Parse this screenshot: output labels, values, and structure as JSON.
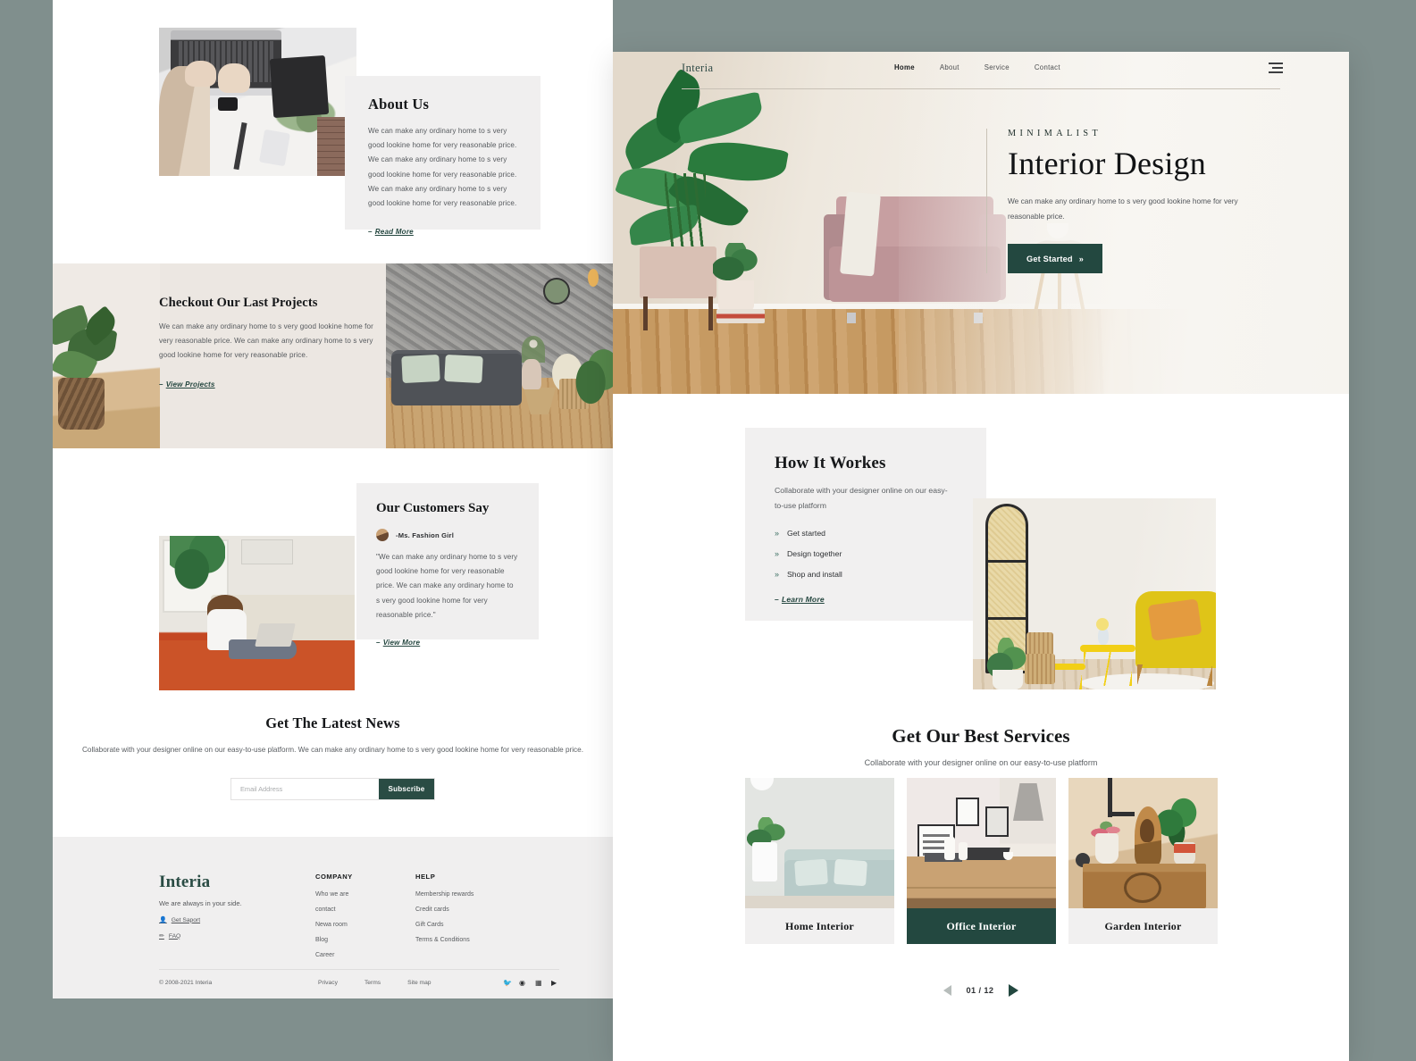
{
  "theme": {
    "canvas_bg": "#808f8d",
    "accent_green": "#234840",
    "panel_grey": "#f1f0f0",
    "band_beige": "#ece7e2"
  },
  "left_screen": {
    "about": {
      "title": "About Us",
      "body": "We can make any ordinary home to s very good lookine home for very reasonable price. We can make any ordinary home to s very good lookine home for very reasonable price. We can make any ordinary home to s very good lookine home for very reasonable price.",
      "link": "Read More",
      "link_dash": "–",
      "photo_alt": "hands-typing-on-laptop-photo"
    },
    "projects": {
      "title": "Checkout Our Last Projects",
      "body": "We can make any ordinary home to s very good lookine home for very reasonable price. We can make any ordinary home to s very good lookine home for very reasonable price.",
      "link": "View Projects",
      "link_dash": "–",
      "photo_alt": "grey-sofa-concrete-wall-living-room-photo"
    },
    "testimonial": {
      "title": "Our Customers Say",
      "author": "-Ms. Fashion Girl",
      "quote": "\"We can make any ordinary home to s very good lookine home for very reasonable price. We can make any ordinary home to s very good lookine home for very reasonable price.\"",
      "link": "View More",
      "link_dash": "–",
      "photo_alt": "woman-sitting-on-floor-with-laptop-photo"
    },
    "newsletter": {
      "title": "Get The Latest News",
      "subtitle": "Collaborate with your designer online on our easy-to-use platform. We can make any ordinary home to s very good lookine home for very reasonable price.",
      "email_placeholder": "Email Address",
      "email_value": "",
      "subscribe_label": "Subscribe"
    },
    "footer": {
      "logo": "Interia",
      "tagline": "We are always in your side.",
      "support_link": "Get Saport",
      "faq_link": "FAQ",
      "columns": [
        {
          "heading": "COMPANY",
          "links": [
            "Who we are",
            "contact",
            "Newa room",
            "Blog",
            "Career"
          ]
        },
        {
          "heading": "HELP",
          "links": [
            "Membership rewards",
            "Credit cards",
            "Gift Cards",
            "Terms & Conditions"
          ]
        }
      ],
      "copyright": "© 2008-2021 Interia",
      "bottom_links": [
        "Privacy",
        "Terms",
        "Site map"
      ],
      "socials": [
        "twitter-icon",
        "facebook-icon",
        "linkedin-icon",
        "youtube-icon"
      ]
    }
  },
  "right_screen": {
    "nav": {
      "logo": "Interia",
      "links": [
        "Home",
        "About",
        "Service",
        "Contact"
      ],
      "active": "Home",
      "menu_icon": "hamburger-icon"
    },
    "hero": {
      "kicker": "MINIMALIST",
      "title": "Interior Design",
      "description": "We can make any ordinary home to s very good lookine home for very reasonable price.",
      "cta_label": "Get Started",
      "cta_chevron": "»",
      "photo_alt": "pink-armchair-plant-wooden-floor-photo"
    },
    "how_it_works": {
      "title": "How It Workes",
      "subtitle": "Collaborate with your designer online on our easy-to-use platform",
      "steps": [
        "Get started",
        "Design together",
        "Shop and install"
      ],
      "step_bullet": "»",
      "link": "Learn More",
      "link_dash": "–",
      "photo_alt": "yellow-armchair-rattan-screen-room-photo"
    },
    "services": {
      "title": "Get Our Best Services",
      "subtitle": "Collaborate with your designer online on our easy-to-use platform",
      "cards": [
        {
          "label": "Home Interior",
          "highlight": false,
          "photo_alt": "mint-sofa-living-room-photo"
        },
        {
          "label": "Office Interior",
          "highlight": true,
          "photo_alt": "office-desk-frames-kitchen-photo"
        },
        {
          "label": "Garden Interior",
          "highlight": false,
          "photo_alt": "wooden-cabinet-plants-statue-photo"
        }
      ],
      "pager": {
        "current": "01 / 12",
        "prev_icon": "triangle-left-icon",
        "next_icon": "triangle-right-icon"
      }
    }
  }
}
